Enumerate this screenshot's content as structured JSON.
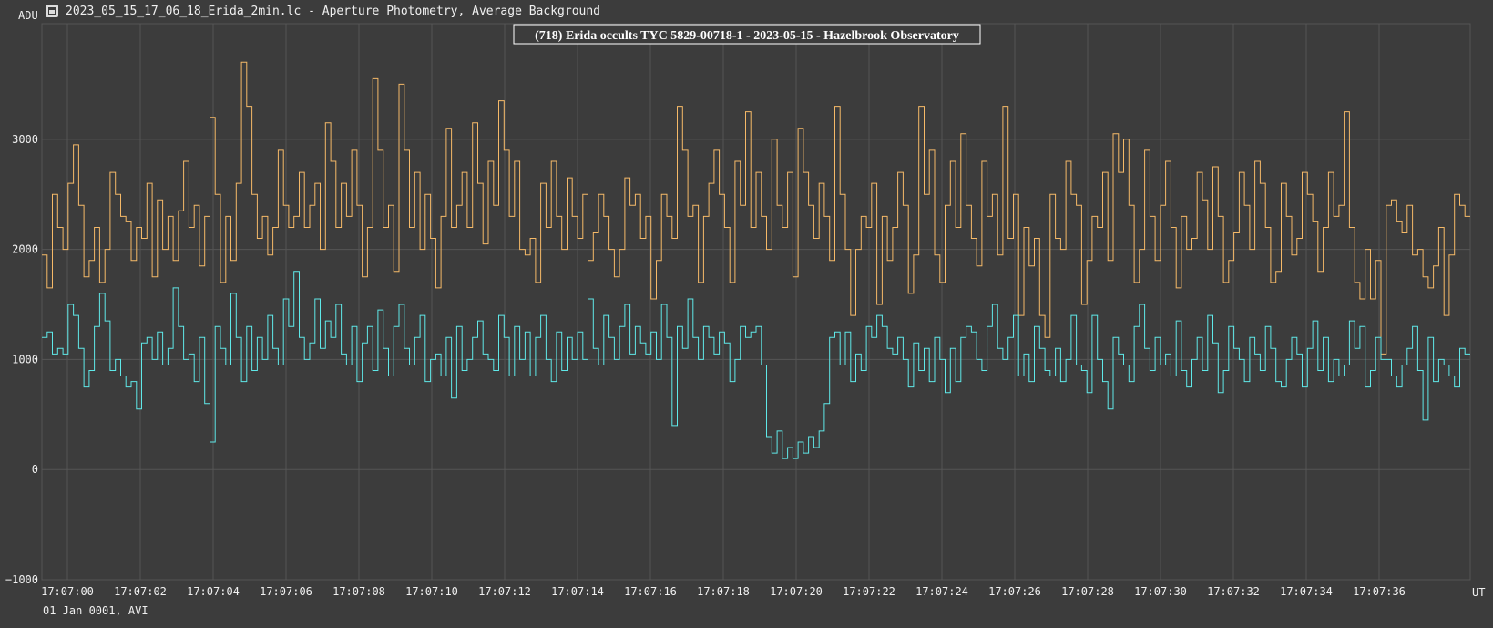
{
  "window": {
    "title": "2023_05_15_17_06_18_Erida_2min.lc - Aperture Photometry, Average Background",
    "icon": "lightcurve-app-icon"
  },
  "footer": {
    "note": "01 Jan 0001, AVI"
  },
  "colors": {
    "background": "#3c3c3c",
    "grid": "#555555",
    "target_series": "#5fe8e8",
    "comparison_series": "#f5b968",
    "text": "#f0f0f0"
  },
  "chart_data": {
    "type": "line",
    "title": "(718) Erida occults TYC 5829-00718-1 - 2023-05-15 - Hazelbrook Observatory",
    "ylabel": "ADU",
    "xlabel": "UT",
    "ylim": [
      -1000,
      4050
    ],
    "xlim_seconds": [
      "16:59.3",
      "17:07:38.5"
    ],
    "grid": true,
    "y_ticks": [
      "3000",
      "2000",
      "1000",
      "0",
      "−1000"
    ],
    "y_tick_values": [
      3000,
      2000,
      1000,
      0,
      -1000
    ],
    "x_ticks": [
      "17:07:00",
      "17:07:02",
      "17:07:04",
      "17:07:06",
      "17:07:08",
      "17:07:10",
      "17:07:12",
      "17:07:14",
      "17:07:16",
      "17:07:18",
      "17:07:20",
      "17:07:22",
      "17:07:24",
      "17:07:26",
      "17:07:28",
      "17:07:30",
      "17:07:32",
      "17:07:34",
      "17:07:36"
    ],
    "series": [
      {
        "color": "#f5b968",
        "x_start": "17:06:59.3",
        "x_end": "17:07:38.5",
        "values": [
          1950,
          1650,
          2500,
          2200,
          2000,
          2600,
          2950,
          2400,
          1750,
          1900,
          2200,
          1700,
          2000,
          2700,
          2500,
          2300,
          2250,
          1900,
          2200,
          2100,
          2600,
          1750,
          2450,
          2000,
          2300,
          1900,
          2350,
          2800,
          2200,
          2400,
          1850,
          2300,
          3200,
          2500,
          1700,
          2300,
          1900,
          2600,
          3700,
          3300,
          2500,
          2100,
          2300,
          1950,
          2200,
          2900,
          2400,
          2200,
          2300,
          2700,
          2200,
          2400,
          2600,
          2000,
          3150,
          2800,
          2200,
          2600,
          2300,
          2900,
          2400,
          1750,
          2200,
          3550,
          2900,
          2200,
          2400,
          1800,
          3500,
          2900,
          2200,
          2700,
          2000,
          2500,
          2100,
          1650,
          2300,
          3100,
          2200,
          2400,
          2700,
          2200,
          3150,
          2600,
          2050,
          2800,
          2400,
          3350,
          2900,
          2300,
          2800,
          2000,
          1950,
          2100,
          1700,
          2600,
          2200,
          2800,
          2300,
          2000,
          2650,
          2300,
          2100,
          2500,
          1900,
          2150,
          2500,
          2300,
          2000,
          1750,
          2000,
          2650,
          2400,
          2500,
          2100,
          2300,
          1550,
          1900,
          2500,
          2300,
          2100,
          3300,
          2900,
          2300,
          2400,
          1700,
          2300,
          2600,
          2900,
          2500,
          2200,
          1700,
          2800,
          2400,
          3250,
          2200,
          2700,
          2300,
          2000,
          3000,
          2400,
          2200,
          2700,
          1750,
          3100,
          2700,
          2400,
          2100,
          2600,
          2300,
          1900,
          3300,
          2500,
          2000,
          1400,
          2000,
          2300,
          2200,
          2600,
          1500,
          2300,
          1900,
          2200,
          2700,
          2400,
          1600,
          1950,
          3300,
          2500,
          2900,
          1950,
          1700,
          2400,
          2800,
          2200,
          3050,
          2400,
          2100,
          1850,
          2800,
          2300,
          2500,
          1950,
          3300,
          2100,
          2500,
          1400,
          2200,
          1850,
          2100,
          1400,
          1200,
          2500,
          2100,
          2000,
          2800,
          2500,
          2400,
          1500,
          1900,
          2300,
          2200,
          2700,
          1900,
          3050,
          2700,
          3000,
          2400,
          1700,
          2000,
          2900,
          2300,
          1900,
          2400,
          2800,
          2200,
          1650,
          2300,
          2000,
          2100,
          2700,
          2450,
          2000,
          2750,
          2300,
          1700,
          1900,
          2150,
          2700,
          2400,
          2000,
          2800,
          2600,
          2200,
          1700,
          1800,
          2600,
          2300,
          1950,
          2100,
          2700,
          2500,
          2250,
          1800,
          2200,
          2700,
          2300,
          2400,
          3250,
          2200,
          1700,
          1550,
          2000,
          1550,
          1900,
          1050,
          2400,
          2450,
          2250,
          2150,
          2400,
          1950,
          2000,
          1750,
          1650,
          1850,
          2200,
          1400,
          1950,
          2500,
          2400,
          2300
        ]
      },
      {
        "color": "#5fe8e8",
        "x_start": "17:06:59.3",
        "x_end": "17:07:38.5",
        "values": [
          1200,
          1250,
          1050,
          1100,
          1050,
          1500,
          1400,
          1100,
          750,
          900,
          1300,
          1600,
          1350,
          900,
          1000,
          850,
          750,
          800,
          550,
          1150,
          1200,
          1000,
          1250,
          950,
          1100,
          1650,
          1300,
          1000,
          1050,
          800,
          1200,
          600,
          250,
          1300,
          1100,
          950,
          1600,
          1200,
          800,
          1300,
          900,
          1200,
          1000,
          1400,
          1100,
          950,
          1550,
          1300,
          1800,
          1200,
          1000,
          1150,
          1550,
          1100,
          1350,
          1200,
          1500,
          1050,
          950,
          1300,
          800,
          1150,
          1300,
          900,
          1450,
          1100,
          850,
          1300,
          1500,
          1100,
          950,
          1200,
          1400,
          800,
          1000,
          1050,
          850,
          1200,
          650,
          1300,
          900,
          1000,
          1200,
          1350,
          1050,
          1000,
          900,
          1400,
          1200,
          850,
          1300,
          1000,
          1250,
          850,
          1200,
          1400,
          1000,
          800,
          1250,
          900,
          1200,
          1000,
          1250,
          1000,
          1550,
          1100,
          950,
          1400,
          1200,
          1000,
          1300,
          1500,
          1050,
          1300,
          1150,
          1050,
          1250,
          1000,
          1500,
          1200,
          400,
          1300,
          1100,
          1550,
          1200,
          1000,
          1300,
          1200,
          1050,
          1250,
          1150,
          800,
          1000,
          1300,
          1200,
          1250,
          1300,
          950,
          300,
          150,
          350,
          100,
          200,
          100,
          250,
          150,
          300,
          200,
          350,
          600,
          1200,
          1250,
          950,
          1250,
          800,
          1050,
          900,
          1300,
          1200,
          1400,
          1300,
          1100,
          1050,
          1200,
          1000,
          750,
          1150,
          900,
          1100,
          800,
          1200,
          1000,
          700,
          1100,
          800,
          1200,
          1300,
          1250,
          1000,
          900,
          1300,
          1500,
          1100,
          1000,
          1200,
          1400,
          850,
          1050,
          800,
          1300,
          1100,
          900,
          850,
          1100,
          800,
          1000,
          1400,
          950,
          900,
          700,
          1400,
          1000,
          800,
          550,
          1200,
          1050,
          950,
          800,
          1300,
          1500,
          1100,
          900,
          1200,
          950,
          1050,
          850,
          1350,
          900,
          750,
          1000,
          1200,
          900,
          1400,
          1150,
          700,
          900,
          1300,
          1100,
          1000,
          800,
          1200,
          1050,
          900,
          1300,
          1100,
          800,
          750,
          1000,
          1200,
          1050,
          750,
          1100,
          1350,
          900,
          1200,
          800,
          1000,
          850,
          950,
          1350,
          1100,
          1300,
          750,
          900,
          1200,
          1000,
          1000,
          850,
          750,
          950,
          1100,
          1300,
          900,
          450,
          1200,
          800,
          1000,
          950,
          850,
          750,
          1100,
          1050
        ]
      }
    ]
  }
}
